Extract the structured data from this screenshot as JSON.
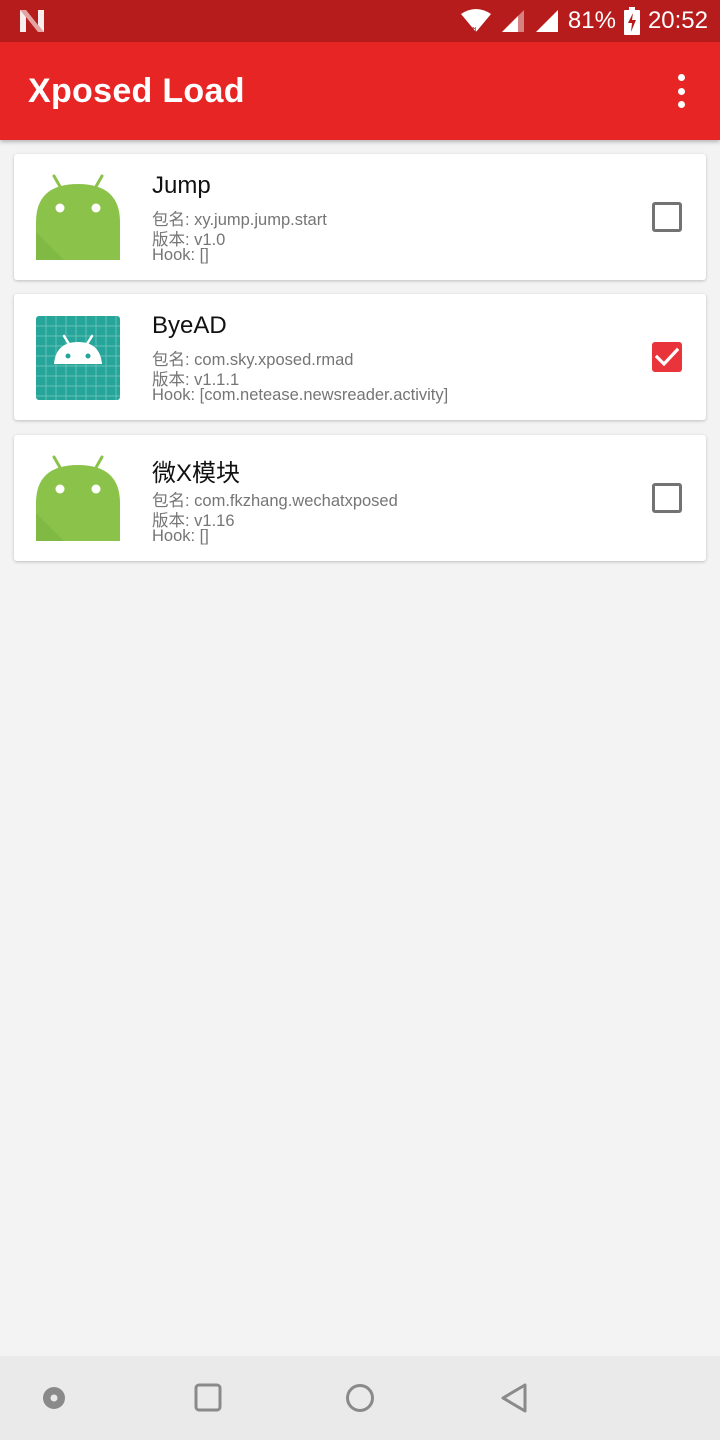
{
  "status_bar": {
    "battery_text": "81%",
    "time": "20:52",
    "left_icon": "n-notification-icon"
  },
  "app_bar": {
    "title": "Xposed Load",
    "menu_icon": "more-vert-icon"
  },
  "modules": [
    {
      "title": "Jump",
      "package": "包名: xy.jump.jump.start",
      "version": "版本: v1.0",
      "hook": "Hook: []",
      "icon": "android-default-icon",
      "checked": false
    },
    {
      "title": "ByeAD",
      "package": "包名: com.sky.xposed.rmad",
      "version": "版本: v1.1.1",
      "hook": "Hook: [com.netease.newsreader.activity]",
      "icon": "android-grid-icon",
      "checked": true
    },
    {
      "title": "微X模块",
      "package": "包名: com.fkzhang.wechatxposed",
      "version": "版本: v1.16",
      "hook": "Hook: []",
      "icon": "android-default-icon",
      "checked": false
    }
  ],
  "nav_bar": {
    "buttons": [
      "dot-icon",
      "recents-square-icon",
      "home-circle-icon",
      "back-triangle-icon"
    ]
  },
  "colors": {
    "status_bar": "#b71c1c",
    "app_bar": "#e82525",
    "checkbox_checked": "#e8343a",
    "android_green": "#8bc34a",
    "teal_icon": "#26a69a"
  }
}
